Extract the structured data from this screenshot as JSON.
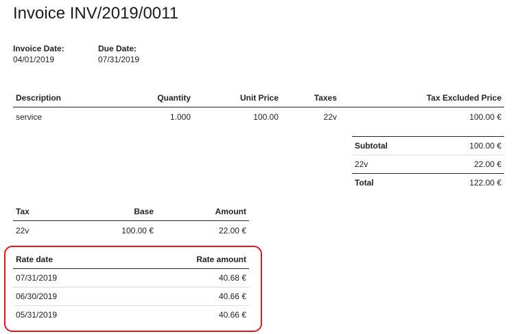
{
  "invoice": {
    "title": "Invoice INV/2019/0011",
    "invoice_date_label": "Invoice Date:",
    "invoice_date": "04/01/2019",
    "due_date_label": "Due Date:",
    "due_date": "07/31/2019"
  },
  "lines": {
    "headers": {
      "description": "Description",
      "quantity": "Quantity",
      "unit_price": "Unit Price",
      "taxes": "Taxes",
      "tax_excluded_price": "Tax Excluded Price"
    },
    "rows": [
      {
        "description": "service",
        "quantity": "1.000",
        "unit_price": "100.00",
        "taxes": "22v",
        "tax_excluded_price": "100.00 €"
      }
    ]
  },
  "totals": {
    "subtotal_label": "Subtotal",
    "subtotal_value": "100.00 €",
    "tax_label": "22v",
    "tax_value": "22.00 €",
    "total_label": "Total",
    "total_value": "122.00 €"
  },
  "tax_summary": {
    "headers": {
      "tax": "Tax",
      "base": "Base",
      "amount": "Amount"
    },
    "rows": [
      {
        "tax": "22v",
        "base": "100.00 €",
        "amount": "22.00 €"
      }
    ]
  },
  "rates": {
    "headers": {
      "rate_date": "Rate date",
      "rate_amount": "Rate amount"
    },
    "rows": [
      {
        "date": "07/31/2019",
        "amount": "40.68 €"
      },
      {
        "date": "06/30/2019",
        "amount": "40.66 €"
      },
      {
        "date": "05/31/2019",
        "amount": "40.66 €"
      }
    ],
    "highlight_color": "#e0161c"
  }
}
